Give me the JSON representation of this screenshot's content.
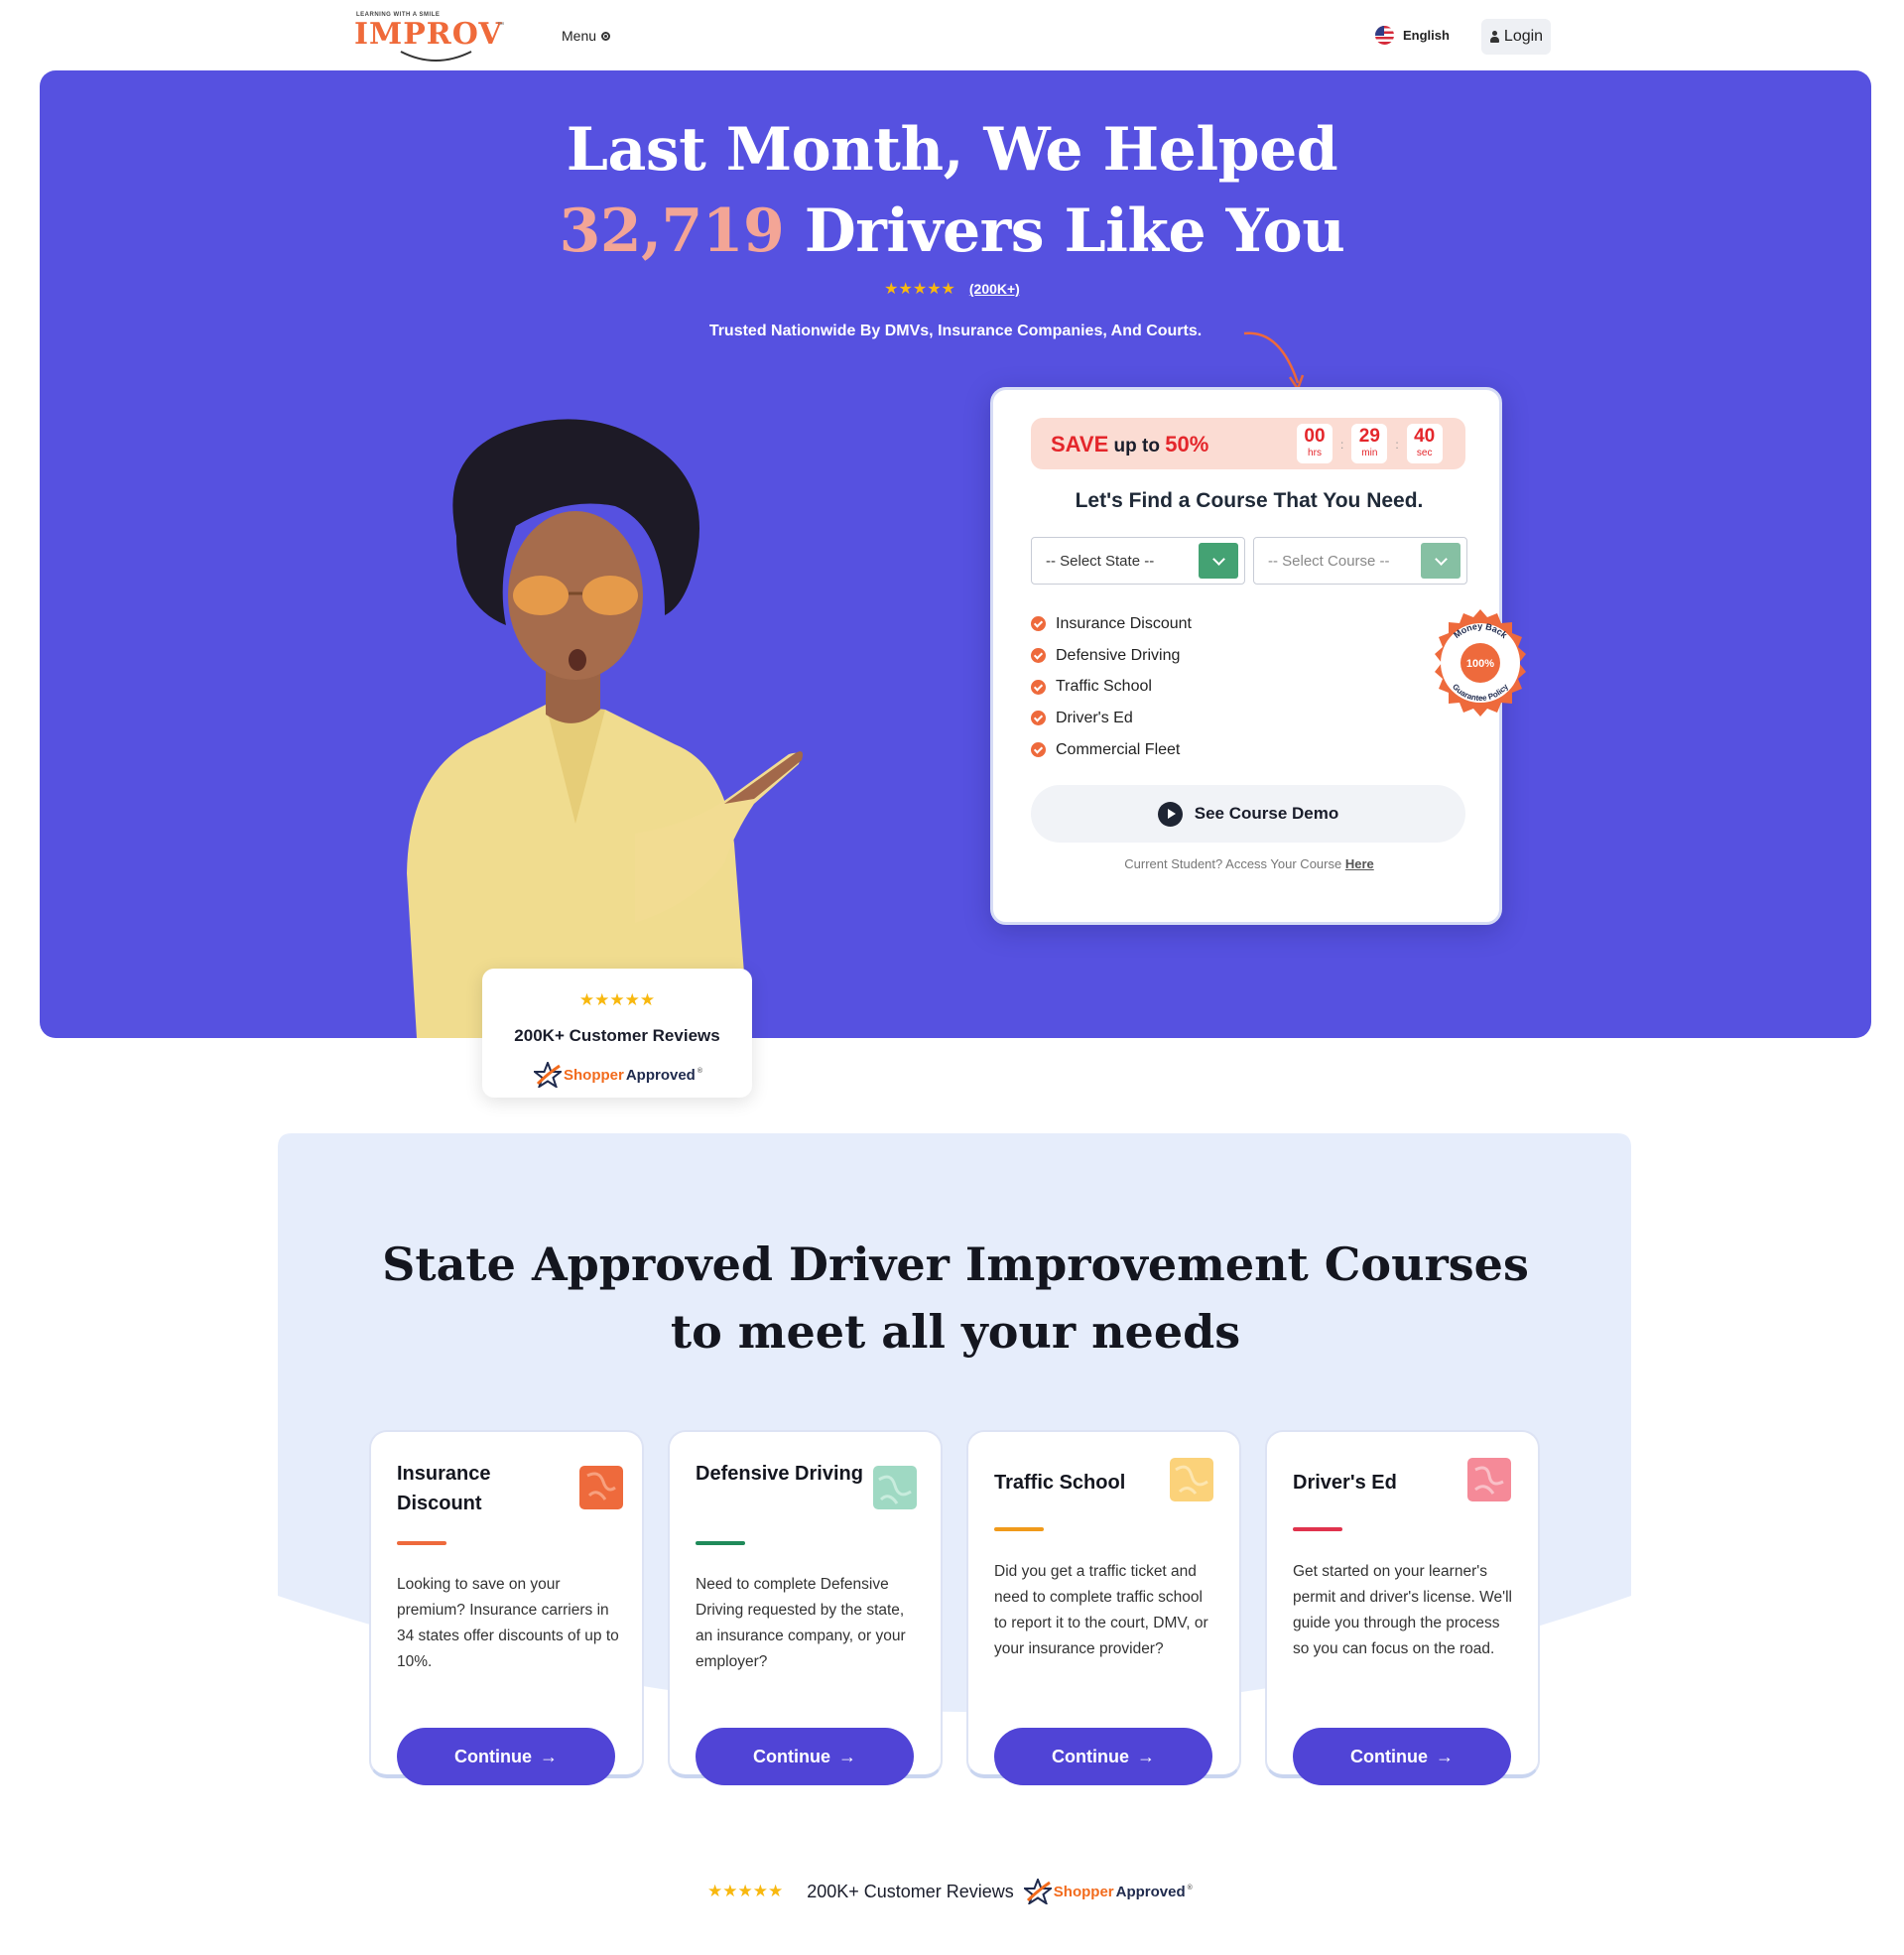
{
  "header": {
    "logo_tagline": "LEARNING WITH A SMILE",
    "logo_text": "IMPROV",
    "logo_tm": "™",
    "menu_label": "Menu",
    "language_label": "English",
    "login_label": "Login"
  },
  "hero": {
    "title_line1": "Last Month, We Helped",
    "title_number": "32,719",
    "title_line2_rest": " Drivers Like You",
    "stars": "★★★★★",
    "rating_count": "(200K+)",
    "trusted_text": "Trusted Nationwide By DMVs, Insurance Companies, And Courts."
  },
  "review_card": {
    "stars": "★★★★★",
    "label": "200K+ Customer Reviews",
    "shopper": "Shopper",
    "approved": "Approved",
    "reg": "®"
  },
  "finder": {
    "save_word": "SAVE",
    "save_mid": " up to ",
    "save_percent": "50%",
    "timer": {
      "hours": "00",
      "hours_unit": "hrs",
      "minutes": "29",
      "minutes_unit": "min",
      "seconds": "40",
      "seconds_unit": "sec",
      "separator": ":"
    },
    "title": "Let's Find a Course That You Need.",
    "state_select": "-- Select State --",
    "course_select": "-- Select Course --",
    "features": [
      "Insurance Discount",
      "Defensive Driving",
      "Traffic School",
      "Driver's Ed",
      "Commercial Fleet"
    ],
    "demo_button": "See Course Demo",
    "current_student": "Current Student? Access Your Course ",
    "here_link": "Here",
    "badge": {
      "top_text": "Money Back",
      "center_text": "100%",
      "bottom_text": "Guarantee Policy"
    }
  },
  "courses": {
    "heading_line1": "State Approved Driver Improvement Courses",
    "heading_line2": "to meet all your needs",
    "cards": [
      {
        "title": "Insurance Discount",
        "description": "Looking to save on your premium? Insurance carriers in 34 states offer discounts of up to 10%.",
        "button": "Continue",
        "accent": "#ee6a3c"
      },
      {
        "title": "Defensive Driving",
        "description": "Need to complete Defensive Driving requested by the state, an insurance company, or your employer?",
        "button": "Continue",
        "accent": "#1f8a5a"
      },
      {
        "title": "Traffic School",
        "description": "Did you get a traffic ticket and need to complete traffic school to report it to the court, DMV, or your insurance provider?",
        "button": "Continue",
        "accent": "#f09a1a"
      },
      {
        "title": "Driver's Ed",
        "description": "Get started on your learner's permit and driver's license. We'll guide you through the process so you can focus on the road.",
        "button": "Continue",
        "accent": "#e0334d"
      }
    ],
    "button_arrow": "→"
  },
  "bottom_reviews": {
    "stars": "★★★★★",
    "label": "200K+ Customer Reviews",
    "shopper": "Shopper",
    "approved": "Approved",
    "reg": "®"
  },
  "colors": {
    "hero_bg": "#5651e0",
    "accent_orange": "#ee6a3c",
    "button_purple": "#5044d6",
    "select_green": "#44a273",
    "section_bg": "#e6edfb"
  }
}
